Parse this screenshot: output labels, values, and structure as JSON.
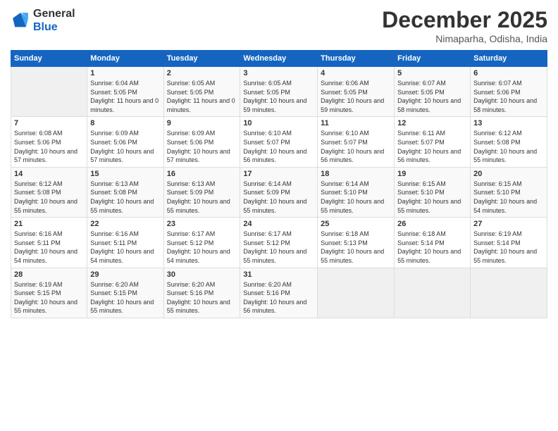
{
  "logo": {
    "line1": "General",
    "line2": "Blue"
  },
  "header": {
    "month": "December 2025",
    "location": "Nimaparha, Odisha, India"
  },
  "weekdays": [
    "Sunday",
    "Monday",
    "Tuesday",
    "Wednesday",
    "Thursday",
    "Friday",
    "Saturday"
  ],
  "weeks": [
    [
      {
        "day": "",
        "info": ""
      },
      {
        "day": "1",
        "info": "Sunrise: 6:04 AM\nSunset: 5:05 PM\nDaylight: 11 hours\nand 0 minutes."
      },
      {
        "day": "2",
        "info": "Sunrise: 6:05 AM\nSunset: 5:05 PM\nDaylight: 11 hours\nand 0 minutes."
      },
      {
        "day": "3",
        "info": "Sunrise: 6:05 AM\nSunset: 5:05 PM\nDaylight: 10 hours\nand 59 minutes."
      },
      {
        "day": "4",
        "info": "Sunrise: 6:06 AM\nSunset: 5:05 PM\nDaylight: 10 hours\nand 59 minutes."
      },
      {
        "day": "5",
        "info": "Sunrise: 6:07 AM\nSunset: 5:05 PM\nDaylight: 10 hours\nand 58 minutes."
      },
      {
        "day": "6",
        "info": "Sunrise: 6:07 AM\nSunset: 5:06 PM\nDaylight: 10 hours\nand 58 minutes."
      }
    ],
    [
      {
        "day": "7",
        "info": "Sunrise: 6:08 AM\nSunset: 5:06 PM\nDaylight: 10 hours\nand 57 minutes."
      },
      {
        "day": "8",
        "info": "Sunrise: 6:09 AM\nSunset: 5:06 PM\nDaylight: 10 hours\nand 57 minutes."
      },
      {
        "day": "9",
        "info": "Sunrise: 6:09 AM\nSunset: 5:06 PM\nDaylight: 10 hours\nand 57 minutes."
      },
      {
        "day": "10",
        "info": "Sunrise: 6:10 AM\nSunset: 5:07 PM\nDaylight: 10 hours\nand 56 minutes."
      },
      {
        "day": "11",
        "info": "Sunrise: 6:10 AM\nSunset: 5:07 PM\nDaylight: 10 hours\nand 56 minutes."
      },
      {
        "day": "12",
        "info": "Sunrise: 6:11 AM\nSunset: 5:07 PM\nDaylight: 10 hours\nand 56 minutes."
      },
      {
        "day": "13",
        "info": "Sunrise: 6:12 AM\nSunset: 5:08 PM\nDaylight: 10 hours\nand 55 minutes."
      }
    ],
    [
      {
        "day": "14",
        "info": "Sunrise: 6:12 AM\nSunset: 5:08 PM\nDaylight: 10 hours\nand 55 minutes."
      },
      {
        "day": "15",
        "info": "Sunrise: 6:13 AM\nSunset: 5:08 PM\nDaylight: 10 hours\nand 55 minutes."
      },
      {
        "day": "16",
        "info": "Sunrise: 6:13 AM\nSunset: 5:09 PM\nDaylight: 10 hours\nand 55 minutes."
      },
      {
        "day": "17",
        "info": "Sunrise: 6:14 AM\nSunset: 5:09 PM\nDaylight: 10 hours\nand 55 minutes."
      },
      {
        "day": "18",
        "info": "Sunrise: 6:14 AM\nSunset: 5:10 PM\nDaylight: 10 hours\nand 55 minutes."
      },
      {
        "day": "19",
        "info": "Sunrise: 6:15 AM\nSunset: 5:10 PM\nDaylight: 10 hours\nand 55 minutes."
      },
      {
        "day": "20",
        "info": "Sunrise: 6:15 AM\nSunset: 5:10 PM\nDaylight: 10 hours\nand 54 minutes."
      }
    ],
    [
      {
        "day": "21",
        "info": "Sunrise: 6:16 AM\nSunset: 5:11 PM\nDaylight: 10 hours\nand 54 minutes."
      },
      {
        "day": "22",
        "info": "Sunrise: 6:16 AM\nSunset: 5:11 PM\nDaylight: 10 hours\nand 54 minutes."
      },
      {
        "day": "23",
        "info": "Sunrise: 6:17 AM\nSunset: 5:12 PM\nDaylight: 10 hours\nand 54 minutes."
      },
      {
        "day": "24",
        "info": "Sunrise: 6:17 AM\nSunset: 5:12 PM\nDaylight: 10 hours\nand 55 minutes."
      },
      {
        "day": "25",
        "info": "Sunrise: 6:18 AM\nSunset: 5:13 PM\nDaylight: 10 hours\nand 55 minutes."
      },
      {
        "day": "26",
        "info": "Sunrise: 6:18 AM\nSunset: 5:14 PM\nDaylight: 10 hours\nand 55 minutes."
      },
      {
        "day": "27",
        "info": "Sunrise: 6:19 AM\nSunset: 5:14 PM\nDaylight: 10 hours\nand 55 minutes."
      }
    ],
    [
      {
        "day": "28",
        "info": "Sunrise: 6:19 AM\nSunset: 5:15 PM\nDaylight: 10 hours\nand 55 minutes."
      },
      {
        "day": "29",
        "info": "Sunrise: 6:20 AM\nSunset: 5:15 PM\nDaylight: 10 hours\nand 55 minutes."
      },
      {
        "day": "30",
        "info": "Sunrise: 6:20 AM\nSunset: 5:16 PM\nDaylight: 10 hours\nand 55 minutes."
      },
      {
        "day": "31",
        "info": "Sunrise: 6:20 AM\nSunset: 5:16 PM\nDaylight: 10 hours\nand 56 minutes."
      },
      {
        "day": "",
        "info": ""
      },
      {
        "day": "",
        "info": ""
      },
      {
        "day": "",
        "info": ""
      }
    ]
  ]
}
